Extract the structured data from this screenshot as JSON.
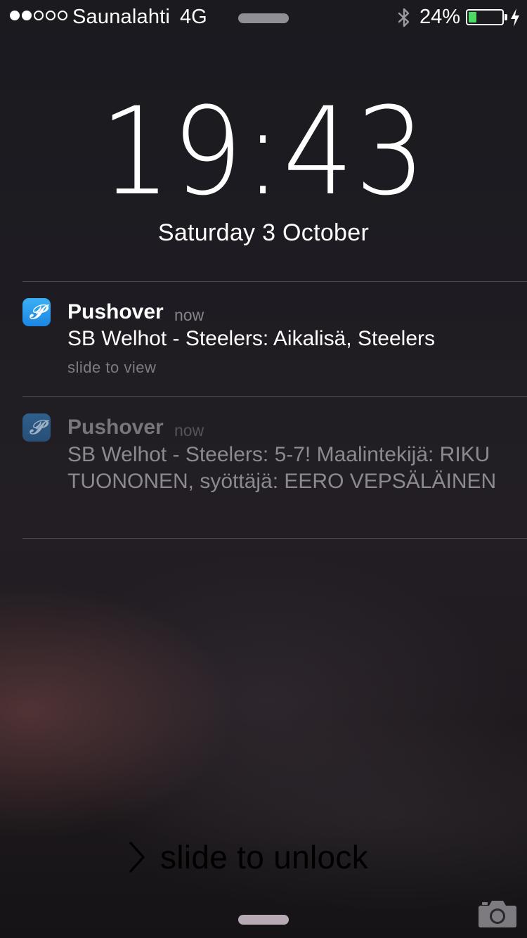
{
  "status_bar": {
    "signal_bars_filled": 2,
    "signal_bars_total": 5,
    "carrier": "Saunalahti",
    "network": "4G",
    "battery_percent_label": "24%",
    "battery_level": 0.24,
    "battery_color": "#4cd964",
    "icons": [
      "bluetooth-icon",
      "battery-icon",
      "charging-bolt-icon"
    ]
  },
  "lock_screen": {
    "time": "19:43",
    "date": "Saturday 3 October"
  },
  "notifications": [
    {
      "app": "Pushover",
      "time": "now",
      "body": "SB Welhot - Steelers: Aikalisä, Steelers",
      "hint": "slide to view",
      "icon": "pushover-app-icon",
      "icon_glyph": "𝒫"
    },
    {
      "app": "Pushover",
      "time": "now",
      "body": "SB Welhot - Steelers: 5-7! Maalintekijä: RIKU TUONONEN, syöttäjä: EERO VEPSÄLÄINEN",
      "icon": "pushover-app-icon",
      "icon_glyph": "𝒫"
    }
  ],
  "unlock": {
    "label": "slide to unlock",
    "icon": "chevron-right-icon"
  },
  "camera": {
    "icon": "camera-icon"
  }
}
